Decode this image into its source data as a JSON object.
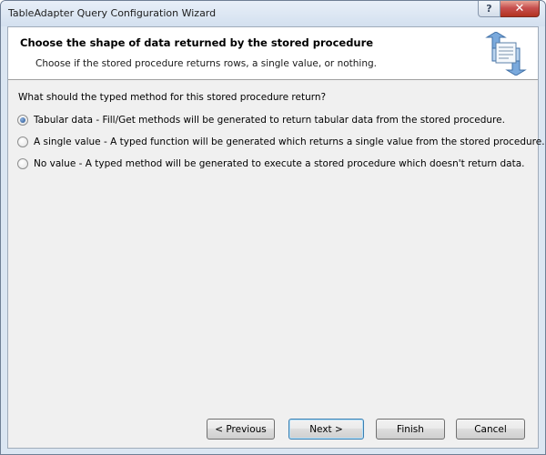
{
  "window": {
    "title": "TableAdapter Query Configuration Wizard",
    "help_label": "?",
    "close_label": "✕"
  },
  "header": {
    "title": "Choose the shape of data returned by the stored procedure",
    "subtitle": "Choose if the stored procedure returns rows, a single value, or nothing.",
    "icon": "wizard-data-transfer-icon"
  },
  "main": {
    "question": "What should the typed method for this stored procedure return?",
    "options": [
      {
        "label": "Tabular data - Fill/Get methods will be generated to return tabular data from the stored procedure.",
        "checked": true
      },
      {
        "label": "A single value - A typed function will be generated which returns a single value from the stored procedure.",
        "checked": false
      },
      {
        "label": "No value - A typed method will be generated to execute a stored procedure which doesn't return data.",
        "checked": false
      }
    ]
  },
  "footer": {
    "previous_label": "< Previous",
    "next_label": "Next >",
    "finish_label": "Finish",
    "cancel_label": "Cancel"
  },
  "colors": {
    "title_bar": "#d3e0ef",
    "client_bg": "#f0f0f0",
    "header_bg": "#ffffff",
    "close_button": "#c75050",
    "radio_selected": "#1f4f8e"
  }
}
